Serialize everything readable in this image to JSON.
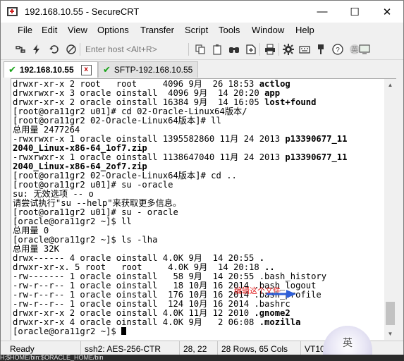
{
  "window": {
    "title": "192.168.10.55 - SecureCRT",
    "minimize_glyph": "—",
    "maximize_glyph": "☐",
    "close_glyph": "✕"
  },
  "menu": [
    "File",
    "Edit",
    "View",
    "Options",
    "Transfer",
    "Script",
    "Tools",
    "Window",
    "Help"
  ],
  "toolbar": {
    "host_placeholder": "Enter host <Alt+R>",
    "icons": [
      "connect-icon",
      "quick-connect-icon",
      "reconnect-icon",
      "disconnect-icon",
      "copy-icon",
      "paste-icon",
      "find-icon",
      "sftp-icon",
      "print-icon",
      "settings-icon",
      "keymap-icon",
      "key-agent-icon",
      "help-icon",
      "ime-icon",
      "screen-icon"
    ]
  },
  "tabs": [
    {
      "label": "192.168.10.55",
      "active": true,
      "status": "connected",
      "close_glyph": "x"
    },
    {
      "label": "SFTP-192.168.10.55",
      "active": false,
      "status": "connected"
    }
  ],
  "terminal": {
    "lines": [
      {
        "text": "drwxr-xr-x 2 root   root     4096 9月  26 18:53 ",
        "bold": "actlog"
      },
      {
        "text": "drwxrwxr-x 3 oracle oinstall  4096 9月  14 20:20 ",
        "bold": "app"
      },
      {
        "text": "drwxr-xr-x 2 oracle oinstall 16384 9月  14 16:05 ",
        "bold": "lost+found"
      },
      {
        "text": "[root@ora11gr2 u01]# cd 02-Oracle-Linux64版本/",
        "bold": ""
      },
      {
        "text": "[root@ora11gr2 02-Oracle-Linux64版本]# ll",
        "bold": ""
      },
      {
        "text": "总用量 2477264",
        "bold": ""
      },
      {
        "text": "-rwxrwxr-x 1 oracle oinstall 1395582860 11月 24 2013 ",
        "bold": "p13390677_11"
      },
      {
        "text": "",
        "bold": "2040_Linux-x86-64_1of7.zip"
      },
      {
        "text": "-rwxrwxr-x 1 oracle oinstall 1138647040 11月 24 2013 ",
        "bold": "p13390677_11"
      },
      {
        "text": "",
        "bold": "2040_Linux-x86-64_2of7.zip"
      },
      {
        "text": "[root@ora11gr2 02-Oracle-Linux64版本]# cd ..",
        "bold": ""
      },
      {
        "text": "[root@ora11gr2 u01]# su -oracle",
        "bold": ""
      },
      {
        "text": "su: 无效选项 -- o",
        "bold": ""
      },
      {
        "text": "请尝试执行\"su --help\"来获取更多信息。",
        "bold": ""
      },
      {
        "text": "[root@ora11gr2 u01]# su - oracle",
        "bold": ""
      },
      {
        "text": "[oracle@ora11gr2 ~]$ ll",
        "bold": ""
      },
      {
        "text": "总用量 0",
        "bold": ""
      },
      {
        "text": "[oracle@ora11gr2 ~]$ ls -lha",
        "bold": ""
      },
      {
        "text": "总用量 32K",
        "bold": ""
      },
      {
        "text": "drwx------ 4 oracle oinstall 4.0K 9月  14 20:55 ",
        "bold": "."
      },
      {
        "text": "drwxr-xr-x. 5 root   root     4.0K 9月  14 20:18 ",
        "bold": ".."
      },
      {
        "text": "-rw------- 1 oracle oinstall   58 9月  14 20:55 .bash_history",
        "bold": ""
      },
      {
        "text": "-rw-r--r-- 1 oracle oinstall   18 10月 16 2014 .bash_logout",
        "bold": ""
      },
      {
        "text": "-rw-r--r-- 1 oracle oinstall  176 10月 16 2014 .bash_profile",
        "bold": ""
      },
      {
        "text": "-rw-r--r-- 1 oracle oinstall  124 10月 16 2014 .bashrc",
        "bold": ""
      },
      {
        "text": "drwxr-xr-x 2 oracle oinstall 4.0K 11月 12 2010 ",
        "bold": ".gnome2"
      },
      {
        "text": "drwxr-xr-x 4 oracle oinstall 4.0K 9月   2 06:08 ",
        "bold": ".mozilla"
      },
      {
        "text": "[oracle@ora11gr2 ~]$ ",
        "bold": ""
      }
    ],
    "annotation": "编辑这个文件"
  },
  "scrollbar": {
    "up_glyph": "▲",
    "down_glyph": "▼"
  },
  "status": {
    "ready": "Ready",
    "cipher": "ssh2: AES-256-CTR",
    "position": "28, 22",
    "size": "28 Rows, 65 Cols",
    "term": "VT100"
  },
  "ime": {
    "label": "英"
  },
  "bottom_strip_text": "H;$HOME/bin:$ORACLE_HOME/bin"
}
